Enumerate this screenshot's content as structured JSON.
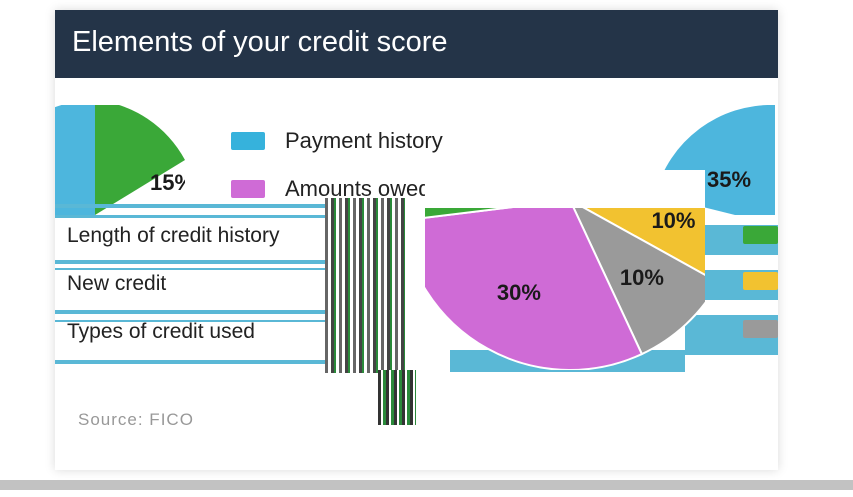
{
  "card": {
    "title": "Elements of your credit score"
  },
  "source_text": "Source: FICO",
  "chart_data": {
    "type": "pie",
    "title": "Elements of your credit score",
    "slices": [
      {
        "label": "Payment history",
        "value": 35,
        "display": "35%",
        "color": "#4db6dd"
      },
      {
        "label": "Amounts owed",
        "value": 30,
        "display": "30%",
        "color": "#cf6bd6"
      },
      {
        "label": "Length of credit history",
        "value": 15,
        "display": "15%",
        "color": "#3aa838"
      },
      {
        "label": "New credit",
        "value": 10,
        "display": "10%",
        "color": "#f2c230"
      },
      {
        "label": "Types of credit used",
        "value": 10,
        "display": "10%",
        "color": "#9a9a9a"
      }
    ],
    "legend": "left"
  }
}
